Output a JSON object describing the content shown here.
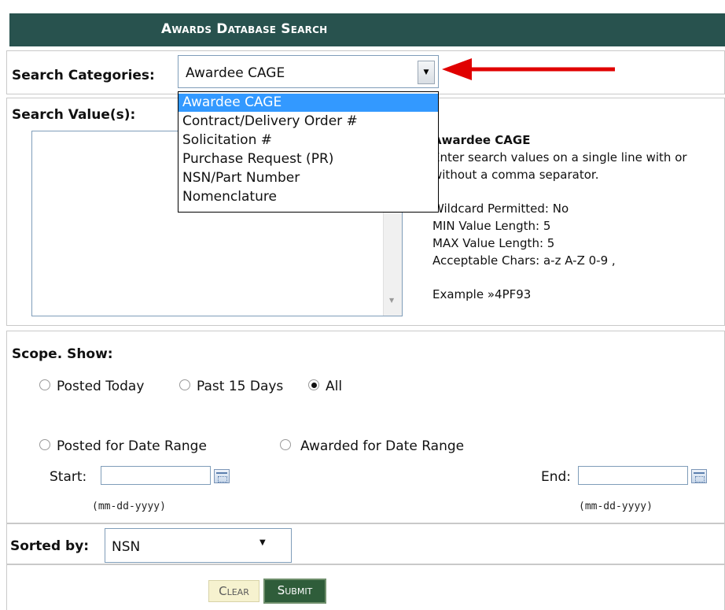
{
  "header": {
    "title": "Awards Database Search"
  },
  "search_categories": {
    "label": "Search Categories:",
    "selected": "Awardee CAGE",
    "options": [
      "Awardee CAGE",
      "Contract/Delivery Order #",
      "Solicitation #",
      "Purchase Request (PR)",
      "NSN/Part Number",
      "Nomenclature"
    ]
  },
  "search_values": {
    "label": "Search Value(s):"
  },
  "help": {
    "title": "Awardee CAGE",
    "line1": "Enter search values on a single line with or",
    "line2": "without a comma separator.",
    "wildcard": "Wildcard Permitted: No",
    "min_len": "MIN Value Length: 5",
    "max_len": "MAX Value Length: 5",
    "chars": "Acceptable Chars: a-z A-Z 0-9 ,",
    "example": "Example »4PF93"
  },
  "scope": {
    "label": "Scope. Show:",
    "options": [
      "Posted Today",
      "Past 15 Days",
      "All"
    ],
    "selected": "All",
    "range_options": [
      "Posted for Date Range",
      "Awarded for Date Range"
    ],
    "start_label": "Start:",
    "end_label": "End:",
    "date_format": "(mm-dd-yyyy)"
  },
  "sort": {
    "label": "Sorted by:",
    "selected": "NSN"
  },
  "buttons": {
    "clear": "Clear",
    "submit": "Submit"
  },
  "colors": {
    "header_bg": "#28524e",
    "highlight": "#3399ff",
    "arrow": "#e00000",
    "submit_bg": "#2f5d3a"
  }
}
